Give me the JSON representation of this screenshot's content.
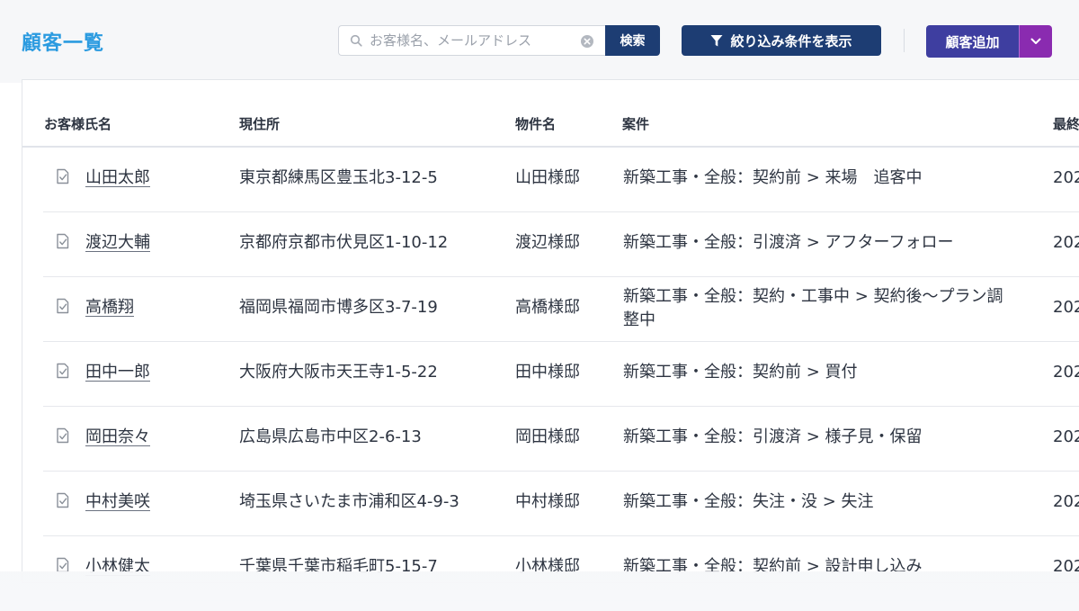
{
  "header": {
    "title": "顧客一覧",
    "search": {
      "placeholder": "お客様名、メールアドレス",
      "button_label": "検索"
    },
    "filter_button_label": "絞り込み条件を表示",
    "add_button_label": "顧客追加"
  },
  "table": {
    "columns": [
      "お客様氏名",
      "現住所",
      "物件名",
      "案件",
      "最終"
    ],
    "rows": [
      {
        "name": "山田太郎",
        "address": "東京都練馬区豊玉北3-12-5",
        "property": "山田様邸",
        "case": "新築工事・全般：契約前 > 来場　追客中",
        "last": "202"
      },
      {
        "name": "渡辺大輔",
        "address": "京都府京都市伏見区1-10-12",
        "property": "渡辺様邸",
        "case": "新築工事・全般：引渡済 > アフターフォロー",
        "last": "202"
      },
      {
        "name": "高橋翔",
        "address": "福岡県福岡市博多区3-7-19",
        "property": "高橋様邸",
        "case": "新築工事・全般：契約・工事中 > 契約後〜プラン調整中",
        "last": "202"
      },
      {
        "name": "田中一郎",
        "address": "大阪府大阪市天王寺1-5-22",
        "property": "田中様邸",
        "case": "新築工事・全般：契約前 > 買付",
        "last": "202"
      },
      {
        "name": "岡田奈々",
        "address": "広島県広島市中区2-6-13",
        "property": "岡田様邸",
        "case": "新築工事・全般：引渡済 > 様子見・保留",
        "last": "202"
      },
      {
        "name": "中村美咲",
        "address": "埼玉県さいたま市浦和区4-9-3",
        "property": "中村様邸",
        "case": "新築工事・全般：失注・没 > 失注",
        "last": "202"
      },
      {
        "name": "小林健太",
        "address": "千葉県千葉市稲毛町5-15-7",
        "property": "小林様邸",
        "case": "新築工事・全般：契約前 > 設計申し込み",
        "last": "202"
      }
    ]
  },
  "colors": {
    "title": "#2b9be0",
    "primary": "#1d3d73",
    "add": "#3e3ea0",
    "add_dropdown": "#8a2bb0"
  }
}
